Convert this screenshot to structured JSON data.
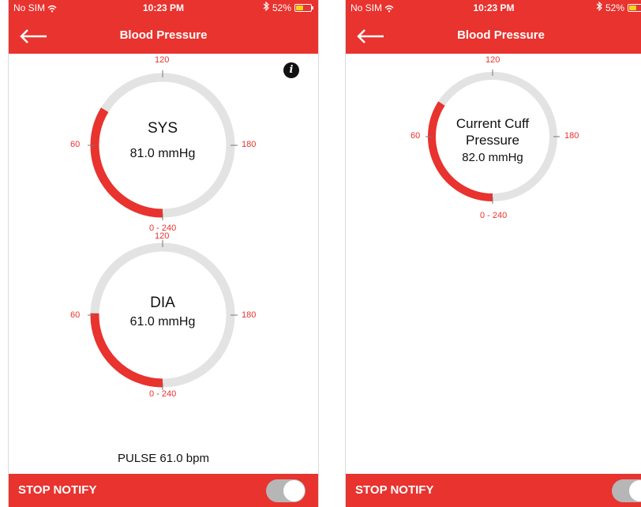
{
  "status_bar": {
    "carrier": "No SIM",
    "time": "10:23 PM",
    "battery": "52%",
    "battery_level": 0.52
  },
  "nav": {
    "title": "Blood Pressure"
  },
  "scale_labels": {
    "top": "120",
    "left": "60",
    "right": "180",
    "bottom": "0 - 240"
  },
  "screens": {
    "left": {
      "gauges": [
        {
          "title": "SYS",
          "value": "81.0 mmHg",
          "reading": 81.0,
          "max": 240
        },
        {
          "title": "DIA",
          "value": "61.0 mmHg",
          "reading": 61.0,
          "max": 240
        }
      ],
      "pulse": "PULSE  61.0 bpm"
    },
    "right": {
      "gauge": {
        "title_line1": "Current Cuff",
        "title_line2": "Pressure",
        "value": "82.0 mmHg",
        "reading": 82.0,
        "max": 240
      }
    }
  },
  "footer": {
    "stop_notify": "STOP NOTIFY",
    "toggle_on": true
  },
  "colors": {
    "accent": "#e8332e",
    "track": "#e3e3e3"
  },
  "icons": {
    "back": "back-arrow-icon",
    "info": "info-icon",
    "wifi": "wifi-icon",
    "bluetooth": "bluetooth-icon",
    "battery": "battery-icon"
  }
}
